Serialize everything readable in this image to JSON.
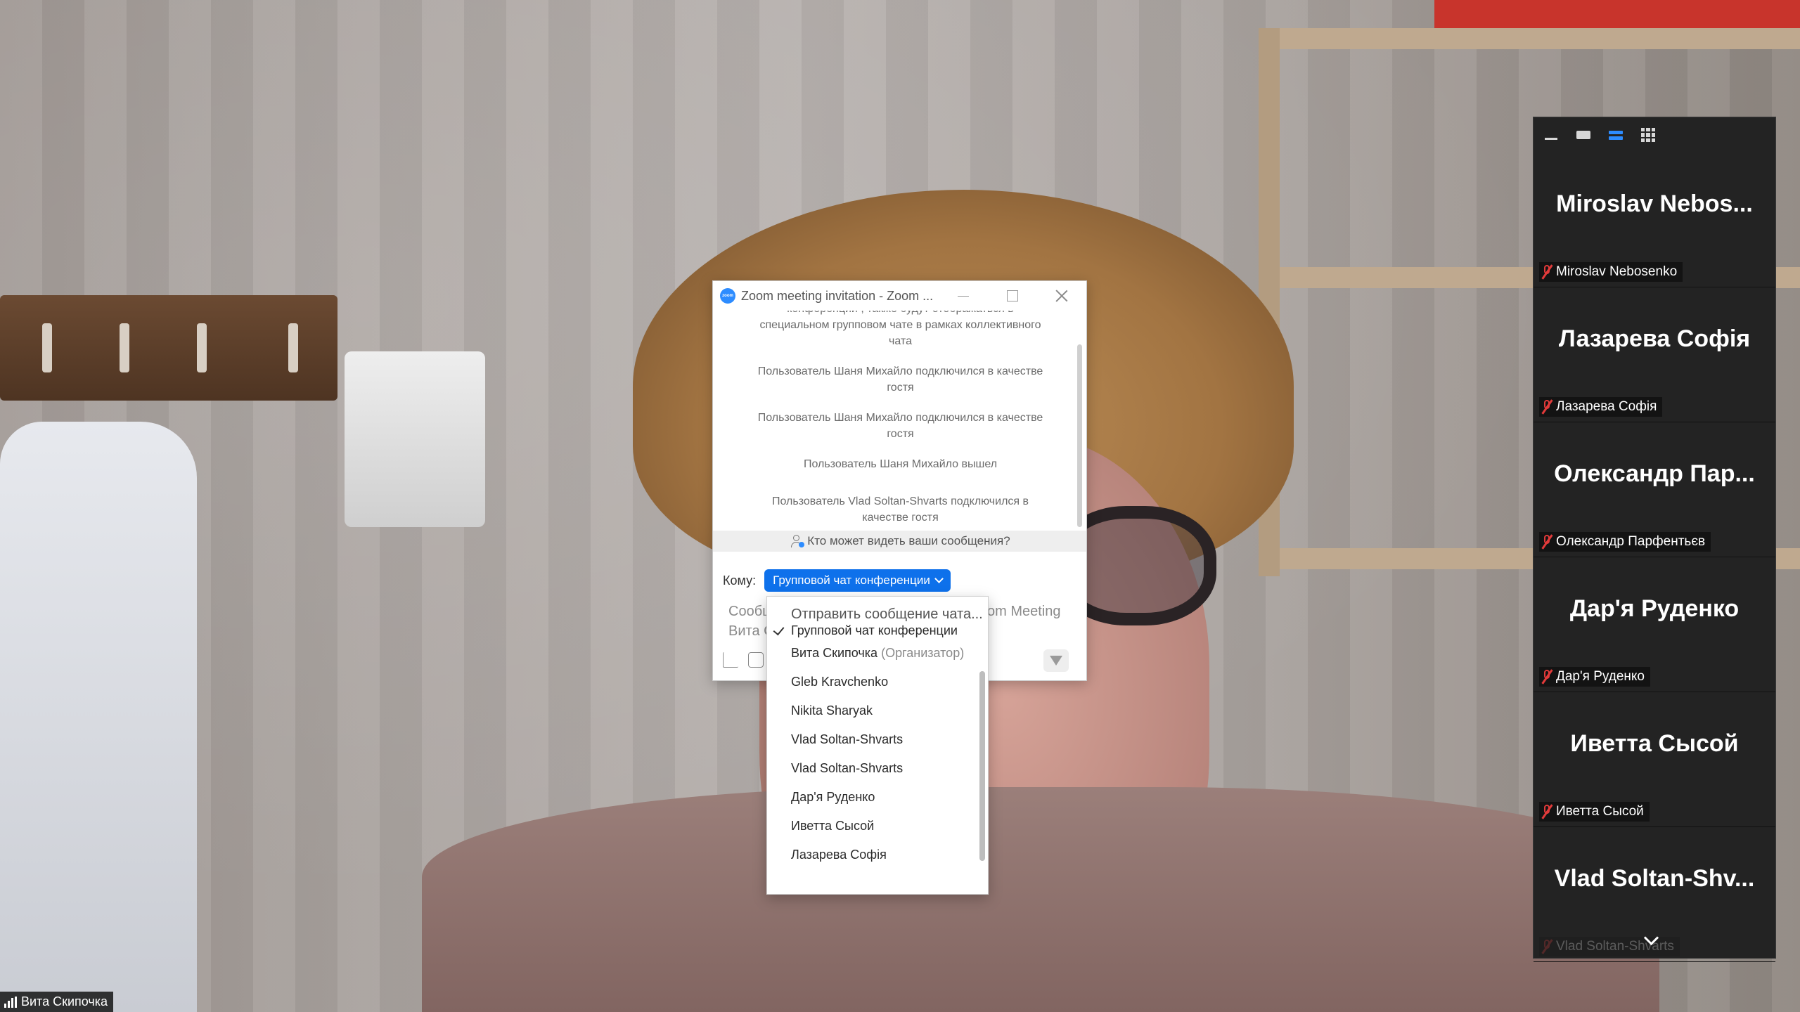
{
  "self_view": {
    "name": "Вита Скипочка"
  },
  "strip": {
    "toolbar": [
      "hide-video",
      "minimize-strip",
      "speaker-view",
      "gallery-view"
    ],
    "participants": [
      {
        "tile_name": "Miroslav  Nebos...",
        "label": "Miroslav Nebosenko"
      },
      {
        "tile_name": "Лазарева Софія",
        "label": "Лазарева Софія"
      },
      {
        "tile_name": "Олександр  Пар...",
        "label": "Олександр Парфентьєв"
      },
      {
        "tile_name": "Дар'я Руденко",
        "label": "Дар'я Руденко"
      },
      {
        "tile_name": "Иветта Сысой",
        "label": "Иветта Сысой"
      },
      {
        "tile_name": "Vlad  Soltan-Shv...",
        "label": "Vlad Soltan-Shvarts"
      }
    ]
  },
  "chat": {
    "title": "Zoom meeting invitation - Zoom ...",
    "messages": [
      "конференции , также будут отображаться в специальном групповом чате в рамках коллективного чата",
      "Пользователь Шаня Михайло подключился в качестве гостя",
      "Пользователь Шаня Михайло подключился в качестве гостя",
      "Пользователь Шаня Михайло вышел",
      "Пользователь Vlad Soltan-Shvarts подключился в качестве гостя"
    ],
    "who_sees": "Кто может видеть ваши сообщения?",
    "to_label": "Кому:",
    "to_value": "Групповой чат конференции",
    "input_left_line1": "Сообщ",
    "input_left_line2": "Вита С",
    "input_right": "om Meeting"
  },
  "dropdown": {
    "search_placeholder": "Отправить сообщение чата...",
    "selected": "Групповой чат конференции",
    "items": [
      {
        "name": "Вита Скипочка",
        "role": "(Организатор)"
      },
      {
        "name": "Gleb Kravchenko",
        "role": ""
      },
      {
        "name": "Nikita Sharyak",
        "role": ""
      },
      {
        "name": "Vlad Soltan-Shvarts",
        "role": ""
      },
      {
        "name": "Vlad Soltan-Shvarts",
        "role": ""
      },
      {
        "name": "Дар'я Руденко",
        "role": ""
      },
      {
        "name": "Иветта Сысой",
        "role": ""
      },
      {
        "name": "Лазарева Софія",
        "role": ""
      }
    ]
  },
  "colors": {
    "accent": "#0e71eb",
    "mute": "#e23a3a",
    "strip_bg": "#232323"
  }
}
